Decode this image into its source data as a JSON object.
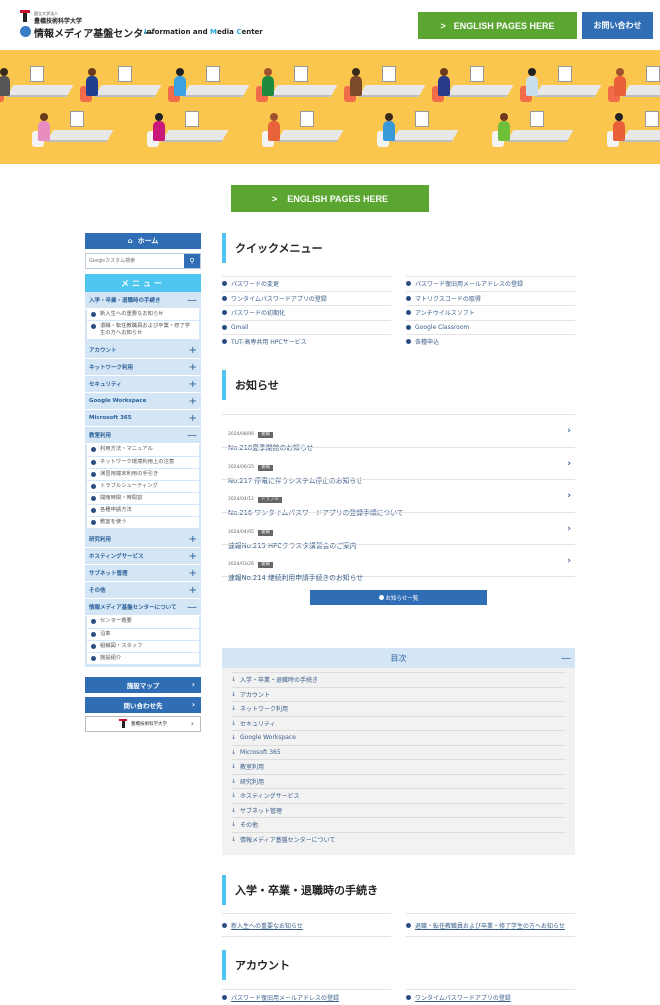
{
  "header": {
    "uni_small": "国立大学法人",
    "university": "豊橋技術科学大学",
    "center_ja": "情報メディア基盤センター",
    "center_en_parts": [
      "I",
      "nformation and ",
      "M",
      "edia ",
      "C",
      "enter"
    ],
    "english_button": "ENGLISH PAGES HERE",
    "contact_button": "お問い合わせ"
  },
  "hero": {
    "alt": "Illustration of people working at computer desks",
    "bg_color": "#fbc64d"
  },
  "english_center_button": "ENGLISH PAGES HERE",
  "sidebar": {
    "home": "ホーム",
    "search_placeholder": "Googleカスタム検索",
    "menu_title": "メニュー",
    "categories": [
      {
        "label": "入学・卒業・退職時の手続き",
        "expanded": true,
        "items": [
          "新入生への重要なお知らせ",
          "退職・転任教職員および卒業・修了学生の方へお知らせ"
        ]
      },
      {
        "label": "アカウント",
        "expanded": false,
        "items": []
      },
      {
        "label": "ネットワーク利用",
        "expanded": false,
        "items": []
      },
      {
        "label": "セキュリティ",
        "expanded": false,
        "items": []
      },
      {
        "label": "Google Workspace",
        "expanded": false,
        "items": []
      },
      {
        "label": "Microsoft 365",
        "expanded": false,
        "items": []
      },
      {
        "label": "教室利用",
        "expanded": true,
        "items": [
          "利用方法・マニュアル",
          "ネットワーク環境利用上の注意",
          "演習用端末利用の手引き",
          "トラブルシューティング",
          "開館時間・時間割",
          "各種申請方法",
          "教室を使う"
        ]
      },
      {
        "label": "研究利用",
        "expanded": false,
        "items": []
      },
      {
        "label": "ホスティングサービス",
        "expanded": false,
        "items": []
      },
      {
        "label": "サブネット管理",
        "expanded": false,
        "items": []
      },
      {
        "label": "その他",
        "expanded": false,
        "items": []
      },
      {
        "label": "情報メディア基盤センターについて",
        "expanded": true,
        "items": [
          "センター概要",
          "沿革",
          "組織図・スタッフ",
          "施設紹介"
        ]
      }
    ],
    "facility_map": "施設マップ",
    "contact": "問い合わせ先",
    "university_banner": "豊橋技術科学大学"
  },
  "quick_menu": {
    "title": "クイックメニュー",
    "left": [
      "パスワードの変更",
      "ワンタイムパスワードアプリの登録",
      "パスワードの初期化",
      "Gmail",
      "TUT-高専共用 HPCサービス"
    ],
    "right": [
      "パスワード復旧用メールアドレスの登録",
      "マトリクスコードの取得",
      "アンチウイルスソフト",
      "Google Classroom",
      "各種申込"
    ]
  },
  "news": {
    "title": "お知らせ",
    "items": [
      {
        "date": "2024/08/06",
        "tag": "速報",
        "title": "No.218夏季閉館のお知らせ"
      },
      {
        "date": "2024/06/25",
        "tag": "速報",
        "title": "No.217 停電に伴うシステム停止のお知らせ"
      },
      {
        "date": "2024/04/12",
        "tag": "トラブル",
        "title": "No.216 ワンタイムパスワードアプリの登録手順について"
      },
      {
        "date": "2024/04/05",
        "tag": "速報",
        "title": "速報No.215 HPCクラスタ講習会のご案内"
      },
      {
        "date": "2024/03/26",
        "tag": "速報",
        "title": "速報No.214 継続利用申請手続きのお知らせ"
      }
    ],
    "all_button": "お知らせ一覧"
  },
  "toc": {
    "title": "目次",
    "items": [
      "入学・卒業・退職時の手続き",
      "アカウント",
      "ネットワーク利用",
      "セキュリティ",
      "Google Workspace",
      "Microsoft 365",
      "教室利用",
      "研究利用",
      "ホスティングサービス",
      "サブネット管理",
      "その他",
      "情報メディア基盤センターについて"
    ]
  },
  "sections": [
    {
      "title": "入学・卒業・退職時の手続き",
      "links": [
        "新入生への重要なお知らせ",
        "退職・転任教職員および卒業・修了学生の方へお知らせ"
      ]
    },
    {
      "title": "アカウント",
      "links": [
        "パスワード復旧用メールアドレスの登録",
        "ワンタイムパスワードアプリの登録"
      ]
    }
  ]
}
